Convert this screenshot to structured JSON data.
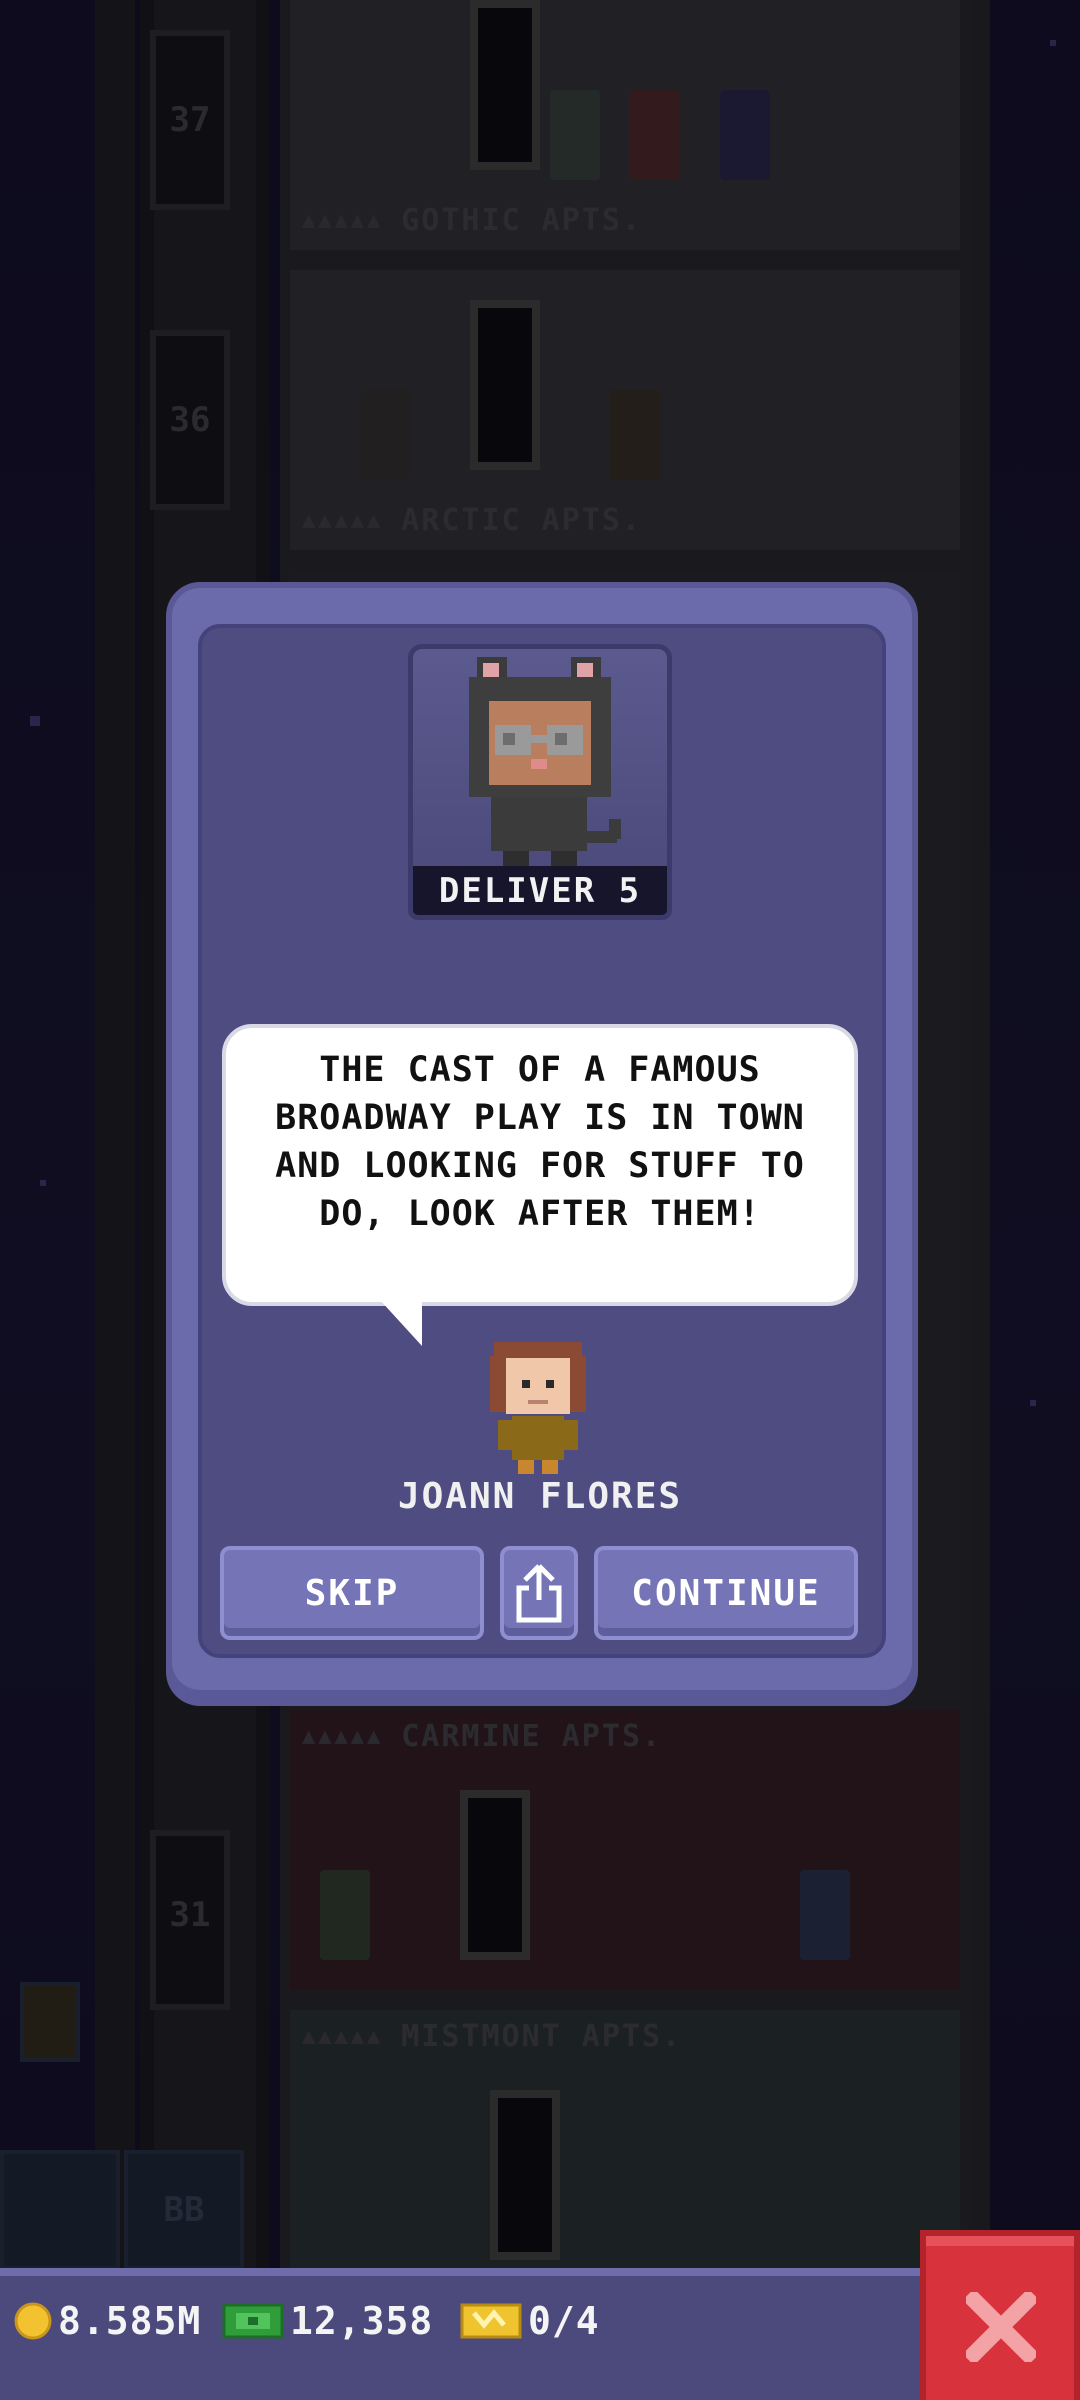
{
  "background": {
    "floors": [
      {
        "number": "37",
        "name": "GOTHIC APTS."
      },
      {
        "number": "36",
        "name": "ARCTIC APTS."
      },
      {
        "number": "",
        "name": "CARMINE APTS."
      },
      {
        "number": "31",
        "name": "MISTMONT APTS."
      }
    ],
    "bottom_left_label": "BB"
  },
  "mission": {
    "objective": "DELIVER 5",
    "message": "THE CAST OF A FAMOUS BROADWAY PLAY IS IN TOWN AND LOOKING FOR STUFF TO DO, LOOK AFTER THEM!",
    "speaker": "JOANN FLORES",
    "buttons": {
      "skip": "SKIP",
      "continue": "CONTINUE"
    }
  },
  "status_bar": {
    "coins": "8.585M",
    "bux": "12,358",
    "tickets": "0/4"
  },
  "colors": {
    "modal_outer": "#6b6aab",
    "modal_inner": "#4e4c80",
    "button": "#7574b6",
    "close_button": "#d8333d",
    "coin": "#f2c230",
    "bux": "#2f9e3a"
  },
  "icons": {
    "share": "share-icon",
    "close": "close-icon",
    "coin": "coin-icon",
    "bux": "bux-icon",
    "ticket": "ticket-icon"
  }
}
